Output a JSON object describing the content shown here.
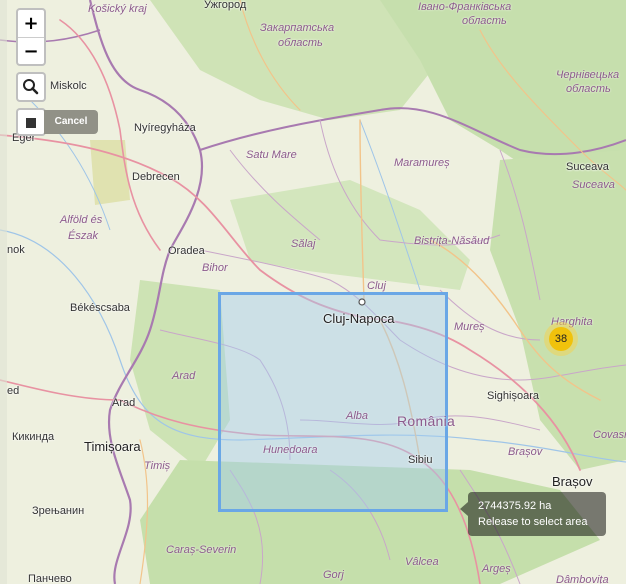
{
  "controls": {
    "zoom_in": "+",
    "zoom_out": "−",
    "search_icon": "search-icon",
    "draw_icon": "square-icon",
    "cancel_label": "Cancel"
  },
  "selection": {
    "area_label": "2744375.92 ha",
    "hint": "Release to select area",
    "fill_color": "#a1cdf0",
    "stroke_color": "#6aa7e6"
  },
  "cluster": {
    "count": "38",
    "color": "#f0c20c"
  },
  "labels": {
    "kosicky": "Košický kraj",
    "uzhgorod": "Ужгород",
    "ivano": "Івано-Франківська",
    "ivano2": "область",
    "zakarpatska": "Закарпатська",
    "zakarpatska2": "область",
    "chernivtsi": "Чернівецька",
    "chernivtsi2": "область",
    "miskolc": "Miskolc",
    "eger": "Eger",
    "nyiregyhaza": "Nyíregyháza",
    "debrecen": "Debrecen",
    "satu_mare": "Satu Mare",
    "maramures": "Maramureș",
    "suceava_city": "Suceava",
    "suceava_region": "Suceava",
    "alfold": "Alföld és",
    "alfold2": "Észak",
    "oradea": "Oradea",
    "bihor": "Bihor",
    "salaj": "Sălaj",
    "bistrita": "Bistrița-Năsăud",
    "nok": "nok",
    "bekescsaba": "Békéscsaba",
    "cluj_region": "Cluj",
    "cluj_napoca": "Cluj-Napoca",
    "mures": "Mureș",
    "harghita": "Harghita",
    "arad_region": "Arad",
    "arad_city": "Arad",
    "ed": "ed",
    "sighisoara": "Sighișoara",
    "alba": "Alba",
    "romania": "România",
    "kikinda": "Кикинда",
    "timisoara": "Timișoara",
    "hunedoara": "Hunedoara",
    "brasov_region": "Brașov",
    "covasna": "Covasn",
    "timis": "Timiș",
    "sibiu": "Sibiu",
    "brasov_city": "Brașov",
    "zrenjanin": "Зрењанин",
    "caras": "Caraș-Severin",
    "valcea": "Vâlcea",
    "dambovita": "Dâmbovița",
    "pancevo": "Панчево",
    "gorj": "Gorj",
    "arges": "Argeș"
  }
}
